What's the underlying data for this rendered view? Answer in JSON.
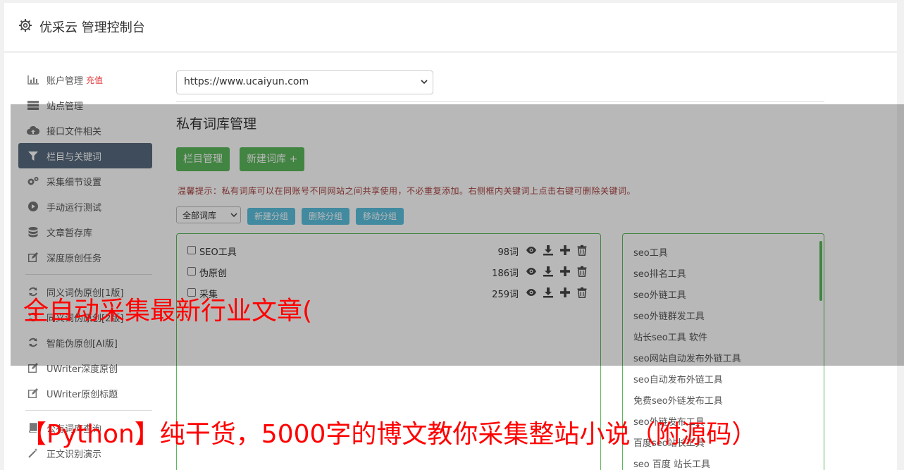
{
  "header": {
    "title": "优采云 管理控制台",
    "icon": "gear-icon"
  },
  "sidebar": {
    "items": [
      {
        "label": "账户管理",
        "badge": "充值",
        "icon": "bar-chart-icon"
      },
      {
        "label": "站点管理",
        "icon": "server-icon"
      },
      {
        "label": "接口文件相关",
        "icon": "cloud-upload-icon"
      },
      {
        "label": "栏目与关键词",
        "icon": "filter-icon"
      },
      {
        "label": "采集细节设置",
        "icon": "cogs-icon"
      },
      {
        "label": "手动运行测试",
        "icon": "play-icon"
      },
      {
        "label": "文章暂存库",
        "icon": "database-icon"
      },
      {
        "label": "深度原创任务",
        "icon": "edit-icon"
      },
      {
        "label": "同义词伪原创[1版]",
        "icon": "refresh-icon"
      },
      {
        "label": "同义词伪原创[2版]",
        "icon": "refresh-icon"
      },
      {
        "label": "智能伪原创[AI版]",
        "icon": "refresh-icon"
      },
      {
        "label": "UWriter深度原创",
        "icon": "edit-icon"
      },
      {
        "label": "UWriter原创标题",
        "icon": "edit-icon"
      },
      {
        "label": "公有词库查询",
        "icon": "book-icon"
      },
      {
        "label": "正文识别演示",
        "icon": "magic-icon"
      }
    ],
    "active_index": 3
  },
  "main": {
    "site_select": "https://www.ucaiyun.com",
    "section_title": "私有词库管理",
    "buttons": {
      "column_manage": "栏目管理",
      "new_library": "新建词库 +"
    },
    "tip": "温馨提示：私有词库可以在同账号不同网站之间共享使用，不必重复添加。右侧框内关键词上点击右键可删除关键词。",
    "filter_select": "全部词库",
    "group_buttons": {
      "new_group": "新建分组",
      "delete_group": "删除分组",
      "move_group": "移动分组"
    },
    "libraries": [
      {
        "name": "SEO工具",
        "count": "98词"
      },
      {
        "name": "伪原创",
        "count": "186词"
      },
      {
        "name": "采集",
        "count": "259词"
      }
    ],
    "keywords": [
      "seo工具",
      "seo排名工具",
      "seo外链工具",
      "seo外链群发工具",
      "站长seo工具 软件",
      "seo网站自动发布外链工具",
      "seo自动发布外链工具",
      "免费seo外链发布工具",
      "seo外链发布工具",
      "百度seo站长工具",
      "seo 百度 站长工具"
    ]
  },
  "overlay": {
    "line1": "全自动采集最新行业文章(",
    "line2": "【Python】纯干货，5000字的博文教你采集整站小说（附源码）"
  },
  "colors": {
    "accent_green": "#5cb85c",
    "accent_blue": "#5bc0de",
    "active_nav": "#586a7e",
    "overlay_red": "#ff0000",
    "tip_red": "#a94442"
  }
}
